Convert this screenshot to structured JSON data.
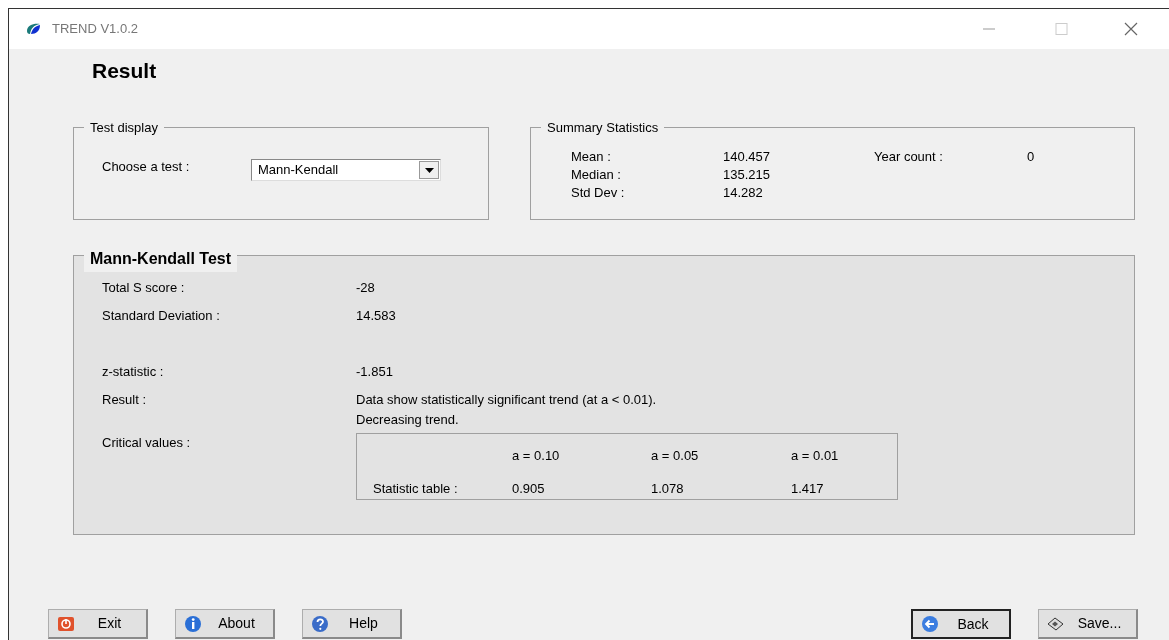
{
  "window": {
    "title": "TREND V1.0.2"
  },
  "heading": "Result",
  "test_display": {
    "title": "Test display",
    "label": "Choose a test :",
    "dropdown": {
      "value": "Mann-Kendall"
    }
  },
  "summary": {
    "title": "Summary Statistics",
    "stats": [
      {
        "label": "Mean :",
        "value": "140.457"
      },
      {
        "label": "Median :",
        "value": "135.215"
      },
      {
        "label": "Std Dev :",
        "value": "14.282"
      }
    ],
    "year_count": {
      "label": "Year count :",
      "value": "0"
    }
  },
  "test": {
    "title": "Mann-Kendall Test",
    "rows": [
      {
        "label": "Total S score  :",
        "lines": [
          "-28"
        ]
      },
      {
        "label": "Standard Deviation :",
        "lines": [
          "14.583"
        ]
      },
      {
        "label": "z-statistic :",
        "lines": [
          "-1.851"
        ]
      },
      {
        "label": "Result :",
        "lines": [
          "Data show statistically significant trend (at a < 0.01).",
          "Decreasing trend."
        ]
      }
    ],
    "critical": {
      "label": "Critical values :",
      "headers": [
        "a = 0.10",
        "a = 0.05",
        "a = 0.01"
      ],
      "row_label": "Statistic table :",
      "values": [
        "0.905",
        "1.078",
        "1.417"
      ]
    }
  },
  "buttons_left": [
    {
      "label": "Exit",
      "kind": "exit",
      "default": false
    },
    {
      "label": "About",
      "kind": "about",
      "default": false
    },
    {
      "label": "Help",
      "kind": "help",
      "default": false
    }
  ],
  "buttons_right": [
    {
      "label": "Back",
      "kind": "back",
      "default": true
    },
    {
      "label": "Save...",
      "kind": "save",
      "default": false
    }
  ]
}
